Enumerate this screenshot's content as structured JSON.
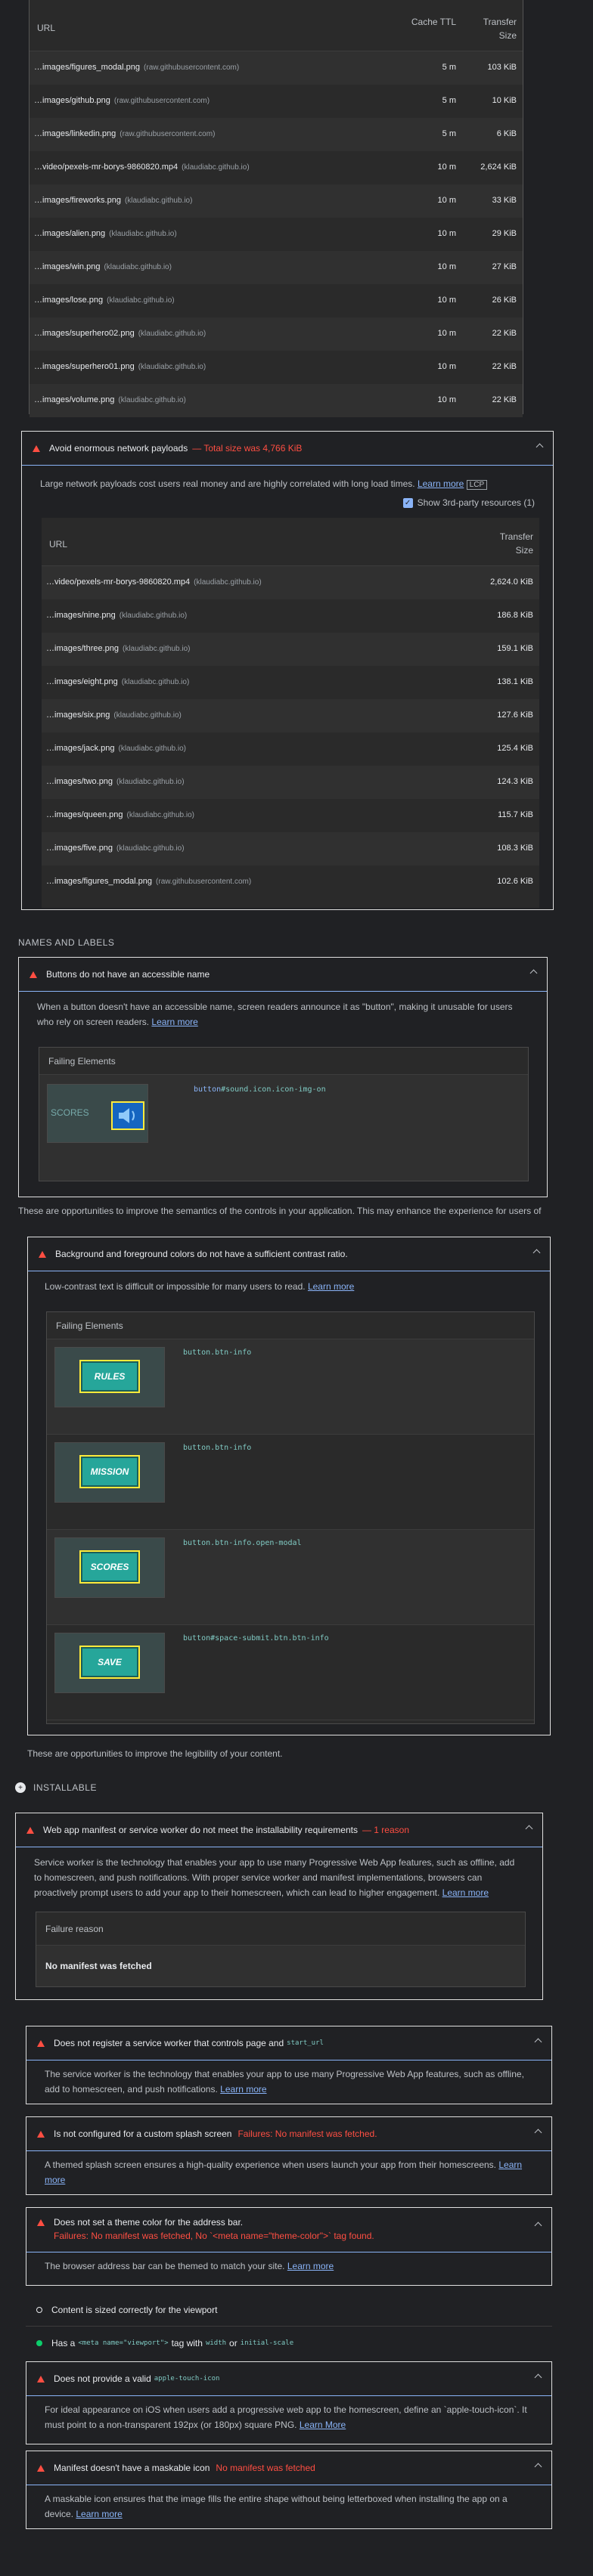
{
  "table1": {
    "headers": {
      "url": "URL",
      "ttl": "Cache TTL",
      "size": "Transfer Size"
    },
    "rows": [
      {
        "name": "…images/figures_modal.png",
        "host": "(raw.githubusercontent.com)",
        "ttl": "5 m",
        "size": "103 KiB"
      },
      {
        "name": "…images/github.png",
        "host": "(raw.githubusercontent.com)",
        "ttl": "5 m",
        "size": "10 KiB"
      },
      {
        "name": "…images/linkedin.png",
        "host": "(raw.githubusercontent.com)",
        "ttl": "5 m",
        "size": "6 KiB"
      },
      {
        "name": "…video/pexels-mr-borys-9860820.mp4",
        "host": "(klaudiabc.github.io)",
        "ttl": "10 m",
        "size": "2,624 KiB"
      },
      {
        "name": "…images/fireworks.png",
        "host": "(klaudiabc.github.io)",
        "ttl": "10 m",
        "size": "33 KiB"
      },
      {
        "name": "…images/alien.png",
        "host": "(klaudiabc.github.io)",
        "ttl": "10 m",
        "size": "29 KiB"
      },
      {
        "name": "…images/win.png",
        "host": "(klaudiabc.github.io)",
        "ttl": "10 m",
        "size": "27 KiB"
      },
      {
        "name": "…images/lose.png",
        "host": "(klaudiabc.github.io)",
        "ttl": "10 m",
        "size": "26 KiB"
      },
      {
        "name": "…images/superhero02.png",
        "host": "(klaudiabc.github.io)",
        "ttl": "10 m",
        "size": "22 KiB"
      },
      {
        "name": "…images/superhero01.png",
        "host": "(klaudiabc.github.io)",
        "ttl": "10 m",
        "size": "22 KiB"
      },
      {
        "name": "…images/volume.png",
        "host": "(klaudiabc.github.io)",
        "ttl": "10 m",
        "size": "22 KiB"
      }
    ]
  },
  "payload": {
    "title": "Avoid enormous network payloads",
    "summary": "— Total size was 4,766 KiB",
    "desc": "Large network payloads cost users real money and are highly correlated with long load times.",
    "learn": "Learn more",
    "badge": "LCP",
    "third_party": "Show 3rd-party resources (1)",
    "headers": {
      "url": "URL",
      "size": "Transfer Size"
    },
    "rows": [
      {
        "name": "…video/pexels-mr-borys-9860820.mp4",
        "host": "(klaudiabc.github.io)",
        "size": "2,624.0 KiB"
      },
      {
        "name": "…images/nine.png",
        "host": "(klaudiabc.github.io)",
        "size": "186.8 KiB"
      },
      {
        "name": "…images/three.png",
        "host": "(klaudiabc.github.io)",
        "size": "159.1 KiB"
      },
      {
        "name": "…images/eight.png",
        "host": "(klaudiabc.github.io)",
        "size": "138.1 KiB"
      },
      {
        "name": "…images/six.png",
        "host": "(klaudiabc.github.io)",
        "size": "127.6 KiB"
      },
      {
        "name": "…images/jack.png",
        "host": "(klaudiabc.github.io)",
        "size": "125.4 KiB"
      },
      {
        "name": "…images/two.png",
        "host": "(klaudiabc.github.io)",
        "size": "124.3 KiB"
      },
      {
        "name": "…images/queen.png",
        "host": "(klaudiabc.github.io)",
        "size": "115.7 KiB"
      },
      {
        "name": "…images/five.png",
        "host": "(klaudiabc.github.io)",
        "size": "108.3 KiB"
      },
      {
        "name": "…images/figures_modal.png",
        "host": "(raw.githubusercontent.com)",
        "size": "102.6 KiB"
      }
    ]
  },
  "names_labels": {
    "heading": "NAMES AND LABELS",
    "title": "Buttons do not have an accessible name",
    "desc": "When a button doesn't have an accessible name, screen readers announce it as \"button\", making it unusable for users who rely on screen readers.",
    "learn": "Learn more",
    "failing": "Failing Elements",
    "el_tag": "button",
    "el_rest": "#sound.icon.icon-img-on",
    "thumb_text": "SCORES",
    "note": "These are opportunities to improve the semantics of the controls in your application. This may enhance the experience for users of"
  },
  "contrast": {
    "title": "Background and foreground colors do not have a sufficient contrast ratio.",
    "desc": "Low-contrast text is difficult or impossible for many users to read.",
    "learn": "Learn more",
    "failing": "Failing Elements",
    "items": [
      {
        "code": "button.btn-info",
        "label": "RULES"
      },
      {
        "code": "button.btn-info",
        "label": "MISSION"
      },
      {
        "code": "button.btn-info.open-modal",
        "label": "SCORES"
      },
      {
        "code": "button#space-submit.btn.btn-info",
        "label": "SAVE"
      }
    ],
    "note": "These are opportunities to improve the legibility of your content."
  },
  "installable": {
    "heading": "INSTALLABLE",
    "title": "Web app manifest or service worker do not meet the installability requirements",
    "summary": "— 1 reason",
    "desc": "Service worker is the technology that enables your app to use many Progressive Web App features, such as offline, add to homescreen, and push notifications. With proper service worker and manifest implementations, browsers can proactively prompt users to add your app to their homescreen, which can lead to higher engagement.",
    "learn": "Learn more",
    "reason_header": "Failure reason",
    "reason": "No manifest was fetched"
  },
  "pwa": {
    "sw": {
      "title": "Does not register a service worker that controls page and",
      "code": "start_url",
      "desc": "The service worker is the technology that enables your app to use many Progressive Web App features, such as offline, add to homescreen, and push notifications.",
      "learn": "Learn more"
    },
    "splash": {
      "title": "Is not configured for a custom splash screen",
      "failure": "Failures: No manifest was fetched.",
      "desc": "A themed splash screen ensures a high-quality experience when users launch your app from their homescreens.",
      "learn": "Learn more"
    },
    "theme": {
      "title": "Does not set a theme color for the address bar.",
      "failure": "Failures: No manifest was fetched, No `<meta name=\"theme-color\">` tag found.",
      "desc": "The browser address bar can be themed to match your site.",
      "learn": "Learn more"
    },
    "viewport": {
      "title": "Content is sized correctly for the viewport"
    },
    "meta": {
      "pre": "Has a",
      "code1": "<meta name=\"viewport\">",
      "mid": "tag with",
      "code2": "width",
      "or": "or",
      "code3": "initial-scale"
    },
    "touch": {
      "title": "Does not provide a valid",
      "code": "apple-touch-icon",
      "desc": "For ideal appearance on iOS when users add a progressive web app to the homescreen, define an `apple-touch-icon`. It must point to a non-transparent 192px (or 180px) square PNG.",
      "learn": "Learn More"
    },
    "maskable": {
      "title": "Manifest doesn't have a maskable icon",
      "failure": "No manifest was fetched",
      "desc": "A maskable icon ensures that the image fills the entire shape without being letterboxed when installing the app on a device.",
      "learn": "Learn more"
    }
  },
  "colors": {
    "fail": "#ff4e42",
    "pass": "#0cce6b",
    "link": "#8ab4f8",
    "teal": "#26a69a"
  }
}
